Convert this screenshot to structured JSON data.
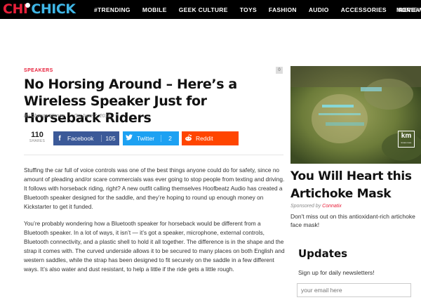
{
  "site": {
    "logo_part1": "CHI",
    "logo_part2": "CHICK"
  },
  "nav": {
    "items": [
      "#TRENDING",
      "MOBILE",
      "GEEK CULTURE",
      "TOYS",
      "FASHION",
      "AUDIO",
      "ACCESSORIES",
      "REVIEWS"
    ],
    "more": "MORE+"
  },
  "article": {
    "category": "SPEAKERS",
    "comment_count": "0",
    "title": "No Horsing Around – Here’s a Wireless Speaker Just for Horseback Riders",
    "author": "By Chance Kinney",
    "date": "On June 7, 2016",
    "paragraphs": [
      "Stuffing the car full of voice controls was one of the best things anyone could do for safety, since no amount of pleading and/or scare commercials was ever going to stop people from texting and driving. It follows with horseback riding, right? A new outfit calling themselves Hoofbeatz Audio has created a Bluetooth speaker designed for the saddle, and they’re hoping to round up enough money on Kickstarter to get it funded.",
      "You’re probably wondering how a Bluetooth speaker for horseback would be different from a Bluetooth speaker. In a lot of ways, it isn’t — it’s got a speaker, microphone, external controls, Bluetooth connectivity, and a plastic shell to hold it all together. The difference is in the shape and the strap it comes with. The curved underside allows it to be secured to many places on both English and western saddles, while the strap has been designed to fit securely on the saddle in a few different ways. It’s also water and dust resistant, to help a little if the ride gets a little rough."
    ]
  },
  "share": {
    "total": "110",
    "total_label": "SHARES",
    "facebook": {
      "label": "Facebook",
      "count": "105",
      "icon": "f"
    },
    "twitter": {
      "label": "Twitter",
      "count": "2",
      "icon": "twitter-bird"
    },
    "reddit": {
      "label": "Reddit",
      "icon": "reddit-alien"
    }
  },
  "sidebar": {
    "video_logo": "km",
    "video_logo_sub": "know more",
    "ad_title": "You Will Heart this Artichoke Mask",
    "sponsored_prefix": "Sponsored by",
    "sponsored_source": "Connatix",
    "ad_description": "Don't miss out on this antioxidant-rich artichoke face mask!",
    "updates_title": "Updates",
    "updates_subtitle": "Sign up for daily newsletters!",
    "email_placeholder": "your email here"
  },
  "colors": {
    "brand_red": "#e8203a",
    "brand_blue": "#3fb6e6",
    "facebook": "#3b5998",
    "twitter": "#1da1f2",
    "reddit": "#ff4500"
  }
}
